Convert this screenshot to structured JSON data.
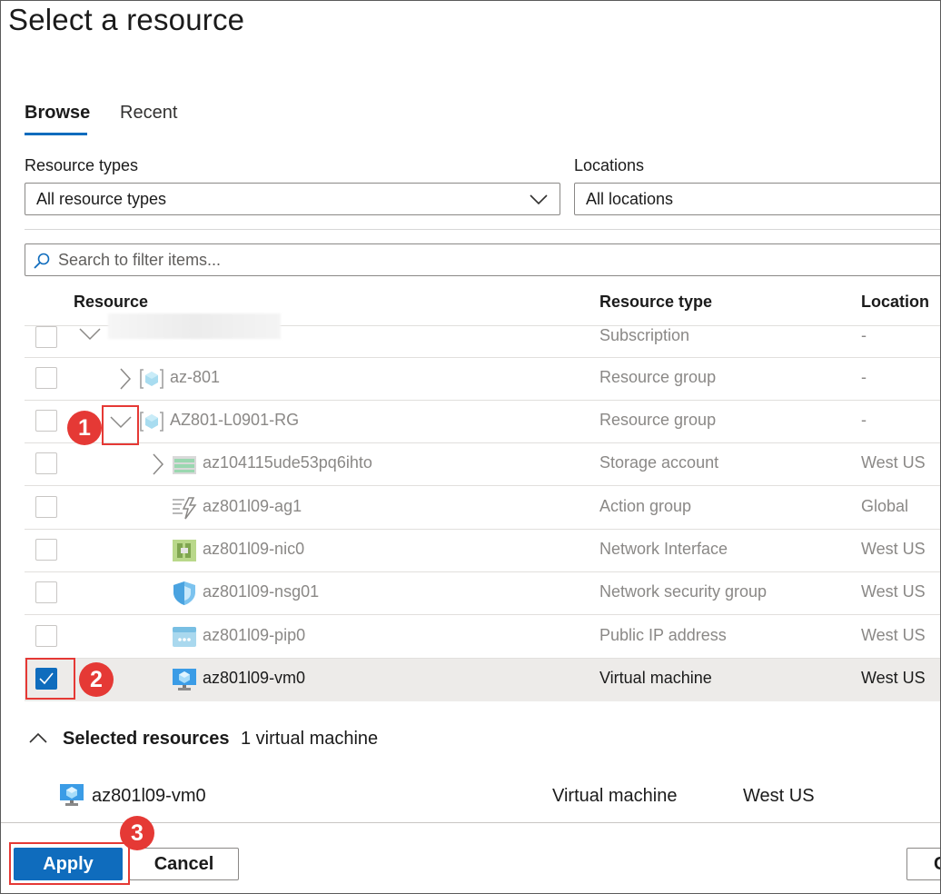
{
  "dialog": {
    "title": "Select a resource"
  },
  "tabs": [
    {
      "label": "Browse",
      "active": true
    },
    {
      "label": "Recent",
      "active": false
    }
  ],
  "filters": {
    "resource_types": {
      "label": "Resource types",
      "value": "All resource types"
    },
    "locations": {
      "label": "Locations",
      "value": "All locations"
    }
  },
  "search": {
    "placeholder": "Search to filter items..."
  },
  "columns": {
    "resource": "Resource",
    "type": "Resource type",
    "location": "Location"
  },
  "rows": [
    {
      "name": "",
      "type": "Subscription",
      "location": "-",
      "icon": "blurred-subscription",
      "expander": "chevron-down",
      "checked": false
    },
    {
      "name": "az-801",
      "type": "Resource group",
      "location": "-",
      "icon": "resource-group-icon",
      "expander": "chevron-right",
      "checked": false
    },
    {
      "name": "AZ801-L0901-RG",
      "type": "Resource group",
      "location": "-",
      "icon": "resource-group-icon",
      "expander": "chevron-down",
      "checked": false
    },
    {
      "name": "az104115ude53pq6ihto",
      "type": "Storage account",
      "location": "West US",
      "icon": "storage-account-icon",
      "expander": "chevron-right",
      "checked": false
    },
    {
      "name": "az801l09-ag1",
      "type": "Action group",
      "location": "Global",
      "icon": "action-group-icon",
      "checked": false
    },
    {
      "name": "az801l09-nic0",
      "type": "Network Interface",
      "location": "West US",
      "icon": "network-interface-icon",
      "checked": false
    },
    {
      "name": "az801l09-nsg01",
      "type": "Network security group",
      "location": "West US",
      "icon": "network-security-group-icon",
      "checked": false
    },
    {
      "name": "az801l09-pip0",
      "type": "Public IP address",
      "location": "West US",
      "icon": "public-ip-icon",
      "checked": false
    },
    {
      "name": "az801l09-vm0",
      "type": "Virtual machine",
      "location": "West US",
      "icon": "virtual-machine-icon",
      "checked": true
    }
  ],
  "annotations": [
    "1",
    "2",
    "3"
  ],
  "selected_resources": {
    "title": "Selected resources",
    "count_label": "1 virtual machine",
    "items": [
      {
        "name": "az801l09-vm0",
        "type": "Virtual machine",
        "location": "West US",
        "icon": "virtual-machine-icon"
      }
    ]
  },
  "buttons": {
    "apply": "Apply",
    "cancel": "Cancel",
    "partial": "C"
  },
  "colors": {
    "accent": "#0f6cbd",
    "annotation": "#e53935"
  }
}
